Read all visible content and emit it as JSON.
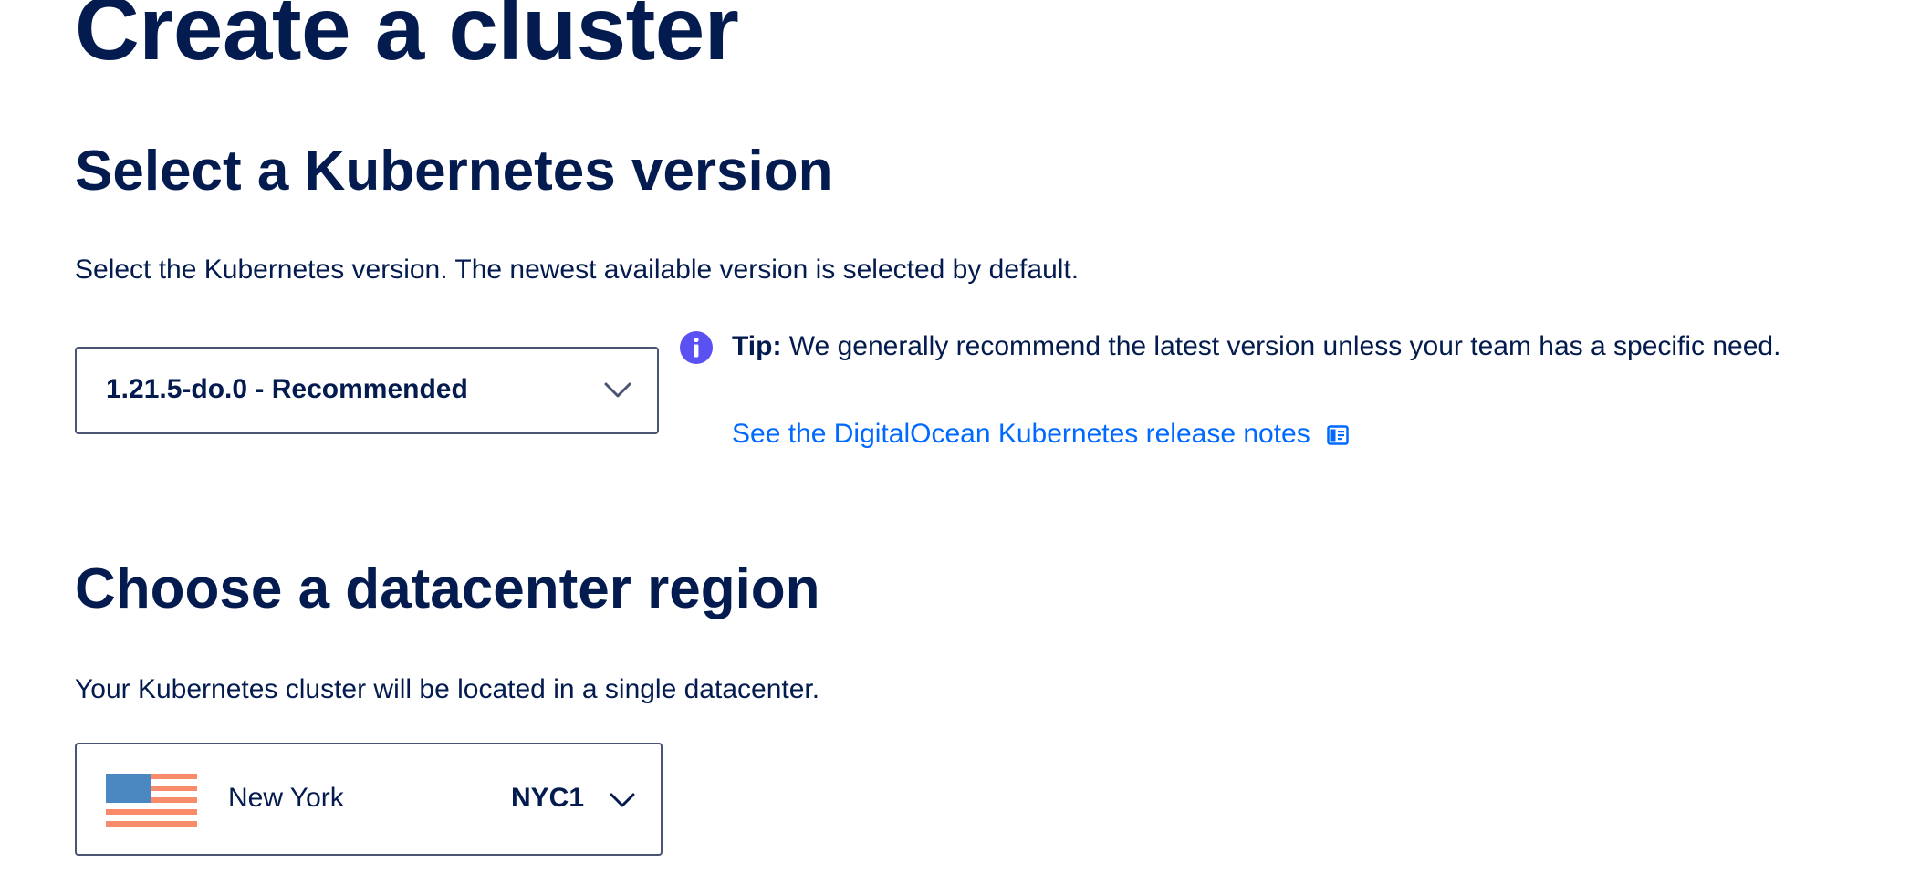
{
  "page": {
    "title": "Create a cluster"
  },
  "version_section": {
    "heading": "Select a Kubernetes version",
    "description": "Select the Kubernetes version. The newest available version is selected by default.",
    "selected_version": "1.21.5-do.0 - Recommended",
    "tip": {
      "label": "Tip:",
      "text": "We generally recommend the latest version unless your team has a specific need.",
      "link_text": "See the DigitalOcean Kubernetes release notes",
      "link_icon": "doc-icon",
      "icon": "info-icon"
    }
  },
  "region_section": {
    "heading": "Choose a datacenter region",
    "description": "Your Kubernetes cluster will be located in a single datacenter.",
    "selected_region": {
      "flag_icon": "us-flag-icon",
      "name": "New York",
      "code": "NYC1"
    }
  },
  "colors": {
    "heading": "#031b4e",
    "link": "#0069ff",
    "info_icon": "#5b50f1",
    "flag_stripe": "#f98b6a",
    "flag_canton": "#4b87c1",
    "border": "#4a5574"
  }
}
